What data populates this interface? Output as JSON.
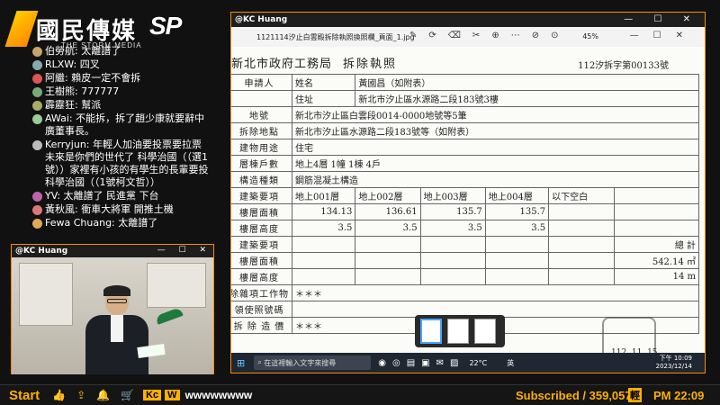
{
  "brand": {
    "name_cn": "國民傳媒",
    "sp": "SP",
    "sub": "THE STORM MEDIA"
  },
  "chat": [
    {
      "user": "伯勞航",
      "text": "太離譜了",
      "color": "#c9a56b"
    },
    {
      "user": "RLXW",
      "text": "四叉",
      "color": "#8aa"
    },
    {
      "user": "阿繼",
      "text": "賴皮一定不會拆",
      "color": "#d55"
    },
    {
      "user": "王樹熊",
      "text": "777777",
      "color": "#7a7"
    },
    {
      "user": "霹靂狂",
      "text": "幫派",
      "color": "#aa6"
    },
    {
      "user": "AWai",
      "text": "不能拆，拆了趙少康就要辭中廣董事長。",
      "color": "#9c9"
    },
    {
      "user": "Kerryjun",
      "text": "年輕人加油要投票要拉票 未來是你們的世代了 科學治國（（選1號））家裡有小孩的有學生的長輩要投科學治國（（1號柯文哲））",
      "color": "#bbb"
    },
    {
      "user": "YV",
      "text": "太離譜了 民進黨 下台",
      "color": "#b6a"
    },
    {
      "user": "黃秋風",
      "text": "衝車大將軍 開推土機",
      "color": "#d77"
    },
    {
      "user": "Fewa Chuang",
      "text": "太離譜了",
      "color": "#da5"
    }
  ],
  "cam": {
    "title": "@KC Huang",
    "controls": "— ☐ ✕"
  },
  "docwin": {
    "title": "@KC Huang",
    "controls": "— ☐ ✕",
    "filename": "1121114汐止白雲殿拆除執照換照欄_頁面_1.jpg",
    "zoom": "45%",
    "toolbar": [
      "✎",
      "⟳",
      "⌫",
      "✂",
      "⊕",
      "⋯",
      "⊘",
      "⊙"
    ]
  },
  "document": {
    "org": "新北市政府工務局",
    "title": "拆除執照",
    "doc_no": "112汐拆字第00133號",
    "rows": [
      {
        "c0": "申請人",
        "c1": "姓名",
        "c2": "黃國昌（如附表）"
      },
      {
        "c0": "",
        "c1": "住址",
        "c2": "新北市汐止區水源路二段183號3樓"
      },
      {
        "c0": "地號",
        "c1": "",
        "c2": "新北市汐止區白雲段0014-0000地號等5筆"
      },
      {
        "c0": "拆除地點",
        "c1": "",
        "c2": "新北市汐止區水源路二段183號等（如附表）"
      },
      {
        "c0": "建物用途",
        "c1": "",
        "c2": "住宅"
      },
      {
        "c0": "層棟戶數",
        "c1": "",
        "c2": "地上4層 1幢 1棟 4戶"
      },
      {
        "c0": "構造種類",
        "c1": "",
        "c2": "鋼筋混凝土構造"
      }
    ],
    "floor_headers": [
      "建築要項",
      "地上001層",
      "地上002層",
      "地上003層",
      "地上004層",
      "以下空白",
      ""
    ],
    "floor_area": [
      "樓層面積",
      "134.13",
      "136.61",
      "135.7",
      "135.7",
      "",
      ""
    ],
    "floor_height": [
      "樓層高度",
      "3.5",
      "3.5",
      "3.5",
      "3.5",
      "",
      ""
    ],
    "sum_headers": [
      "建築要項",
      "",
      "",
      "",
      "",
      "",
      "總 計"
    ],
    "sum_area": [
      "樓層面積",
      "",
      "",
      "",
      "",
      "",
      "542.14 ㎡"
    ],
    "sum_height": [
      "樓層高度",
      "",
      "",
      "",
      "",
      "",
      "14 m"
    ],
    "extra": [
      {
        "label": "除雜項工作物",
        "value": "＊＊＊"
      },
      {
        "label": "領使照號碼",
        "value": ""
      },
      {
        "label": "拆 除 造 價",
        "value": "＊＊＊"
      }
    ],
    "stamp_date": "112. 11. 15"
  },
  "taskbar": {
    "search_placeholder": "在這裡輸入文字來搜尋",
    "weather": "22°C",
    "lang": "英",
    "time": "下午 10:09",
    "date": "2023/12/14"
  },
  "bottom": {
    "start": "Start",
    "kc": "Kc",
    "w": "W",
    "marquee": "wwwwwwww",
    "subscribed": "Subscribed / 359,057",
    "badge": "輕",
    "clock": "PM 22:09"
  }
}
